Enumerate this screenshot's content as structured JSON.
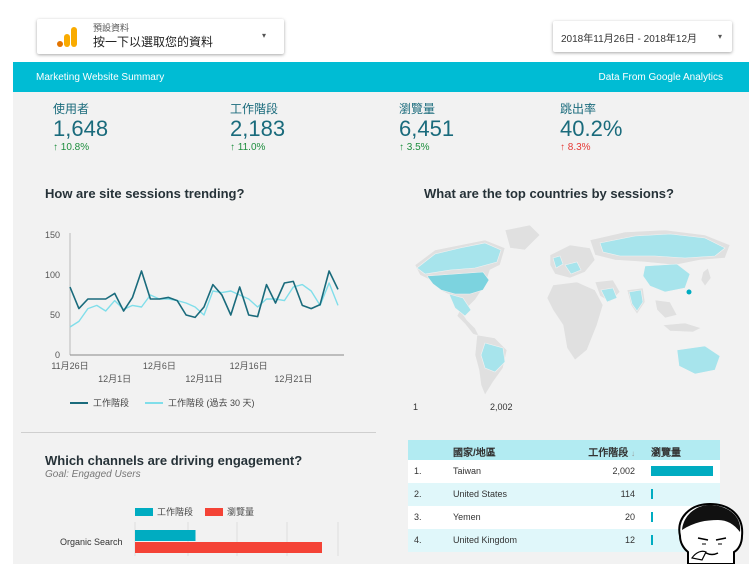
{
  "datasource": {
    "small_label": "預設資料",
    "main_label": "按一下以選取您的資料",
    "caret": "▾"
  },
  "daterange": {
    "label": "2018年11月26日 - 2018年12月",
    "caret": "▾"
  },
  "header": {
    "left": "Marketing Website Summary",
    "right": "Data From Google Analytics"
  },
  "kpis": [
    {
      "label": "使用者",
      "value": "1,648",
      "delta": "↑ 10.8%",
      "direction": "up"
    },
    {
      "label": "工作階段",
      "value": "2,183",
      "delta": "↑ 11.0%",
      "direction": "up"
    },
    {
      "label": "瀏覽量",
      "value": "6,451",
      "delta": "↑ 3.5%",
      "direction": "up"
    },
    {
      "label": "跳出率",
      "value": "40.2%",
      "delta": "↑ 8.3%",
      "direction": "down"
    }
  ],
  "trend_panel": {
    "title": "How are site sessions trending?",
    "legend": [
      "工作階段",
      "工作階段 (過去 30 天)"
    ]
  },
  "channels_panel": {
    "title": "Which channels are driving engagement?",
    "goal": "Goal: Engaged Users",
    "legend": [
      "工作階段",
      "瀏覽量"
    ],
    "first_channel": "Organic Search"
  },
  "map_panel": {
    "title": "What are the top countries by sessions?",
    "legend_min": "1",
    "legend_max": "2,002"
  },
  "table": {
    "headers": {
      "country": "國家/地區",
      "sessions": "工作階段",
      "sort": "↓",
      "views": "瀏覽量"
    },
    "rows": [
      {
        "idx": "1.",
        "country": "Taiwan",
        "sessions": "2,002",
        "views_fraction": 1.0
      },
      {
        "idx": "2.",
        "country": "United States",
        "sessions": "114",
        "views_fraction": 0.03
      },
      {
        "idx": "3.",
        "country": "Yemen",
        "sessions": "20",
        "views_fraction": 0.02
      },
      {
        "idx": "4.",
        "country": "United Kingdom",
        "sessions": "12",
        "views_fraction": 0.02
      }
    ]
  },
  "colors": {
    "teal": "#00bcd4",
    "series_current": "#1a6b7c",
    "series_previous": "#80deea",
    "bar_sessions": "#00acc1",
    "bar_views": "#f44336"
  },
  "chart_data": [
    {
      "type": "line",
      "title": "How are site sessions trending?",
      "xlabel": "",
      "ylabel": "",
      "ylim": [
        0,
        150
      ],
      "yticks": [
        0,
        50,
        100,
        150
      ],
      "x_tick_labels_row1": [
        "11月26日",
        "12月6日",
        "12月16日"
      ],
      "x_tick_labels_row2": [
        "12月1日",
        "12月11日",
        "12月21日"
      ],
      "x_tick_index_row1": [
        0,
        10,
        20
      ],
      "x_tick_index_row2": [
        5,
        15,
        25
      ],
      "n_points": 30,
      "series": [
        {
          "name": "工作階段",
          "values": [
            85,
            58,
            70,
            70,
            70,
            77,
            55,
            72,
            105,
            70,
            70,
            72,
            68,
            50,
            47,
            60,
            88,
            75,
            50,
            85,
            50,
            48,
            88,
            65,
            90,
            92,
            62,
            58,
            63,
            105,
            82
          ]
        },
        {
          "name": "工作階段 (過去 30 天)",
          "values": [
            35,
            42,
            58,
            62,
            55,
            68,
            57,
            62,
            60,
            75,
            70,
            70,
            68,
            65,
            60,
            50,
            80,
            78,
            80,
            75,
            70,
            60,
            70,
            70,
            68,
            85,
            88,
            80,
            62,
            90,
            62
          ]
        }
      ]
    },
    {
      "type": "bar",
      "title": "Which channels are driving engagement?",
      "categories": [
        "Organic Search"
      ],
      "series": [
        {
          "name": "工作階段",
          "values": [
            1100
          ]
        },
        {
          "name": "瀏覽量",
          "values": [
            3400
          ]
        }
      ]
    }
  ]
}
